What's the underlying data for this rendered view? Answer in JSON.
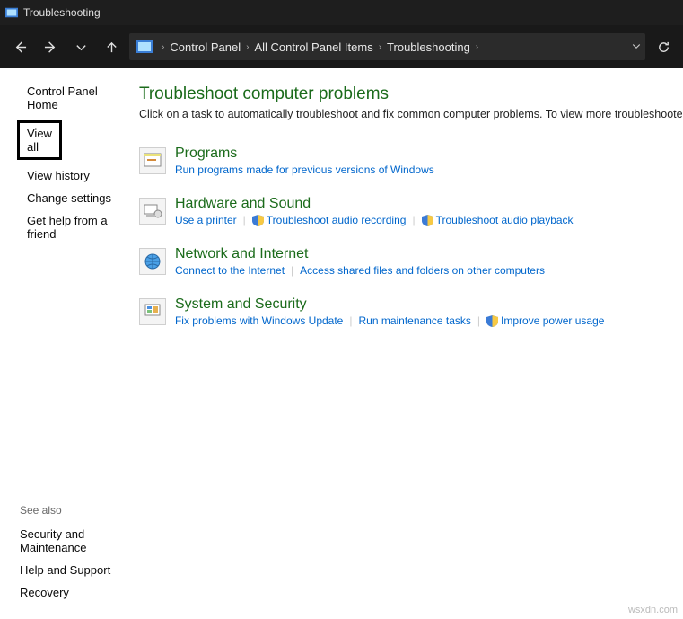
{
  "window": {
    "title": "Troubleshooting"
  },
  "breadcrumb": {
    "items": [
      "Control Panel",
      "All Control Panel Items",
      "Troubleshooting"
    ]
  },
  "sidebar": {
    "top": {
      "home": "Control Panel Home",
      "viewall": "View all",
      "history": "View history",
      "change": "Change settings",
      "friend": "Get help from a friend"
    },
    "see_also_label": "See also",
    "bottom": {
      "secmaint": "Security and Maintenance",
      "help": "Help and Support",
      "recovery": "Recovery"
    }
  },
  "main": {
    "heading": "Troubleshoot computer problems",
    "description": "Click on a task to automatically troubleshoot and fix common computer problems. To view more troubleshooters, click on a category or use the Search box."
  },
  "categories": {
    "programs": {
      "title": "Programs",
      "link1": "Run programs made for previous versions of Windows"
    },
    "hardware": {
      "title": "Hardware and Sound",
      "link1": "Use a printer",
      "link2": "Troubleshoot audio recording",
      "link3": "Troubleshoot audio playback"
    },
    "network": {
      "title": "Network and Internet",
      "link1": "Connect to the Internet",
      "link2": "Access shared files and folders on other computers"
    },
    "system": {
      "title": "System and Security",
      "link1": "Fix problems with Windows Update",
      "link2": "Run maintenance tasks",
      "link3": "Improve power usage"
    }
  },
  "watermark": "wsxdn.com"
}
